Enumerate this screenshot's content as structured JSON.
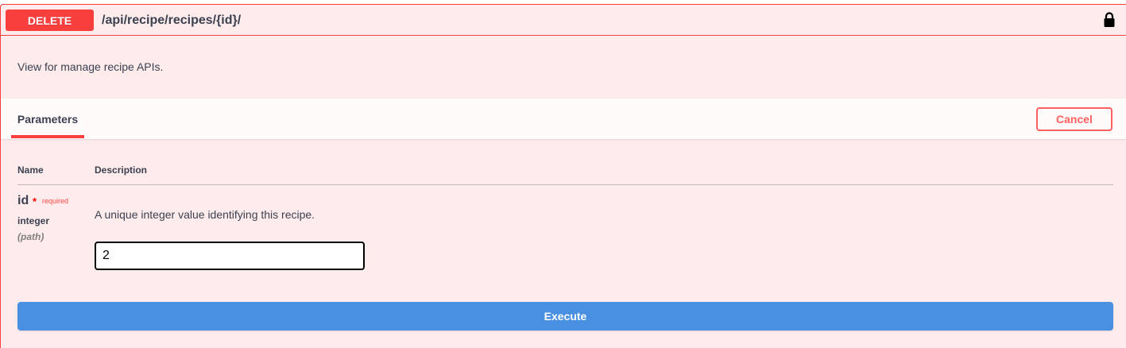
{
  "operation": {
    "method": "DELETE",
    "path": "/api/recipe/recipes/{id}/",
    "description": "View for manage recipe APIs.",
    "lock_icon": "lock-icon"
  },
  "parameters_section": {
    "tab_label": "Parameters",
    "cancel_label": "Cancel",
    "columns": [
      "Name",
      "Description"
    ],
    "params": [
      {
        "name": "id",
        "required_star": "*",
        "required_label": "required",
        "type": "integer",
        "in": "(path)",
        "description": "A unique integer value identifying this recipe.",
        "value": "2"
      }
    ]
  },
  "execute_label": "Execute",
  "colors": {
    "delete": "#f93e3e",
    "background": "#feebeb",
    "execute": "#4990e2"
  }
}
